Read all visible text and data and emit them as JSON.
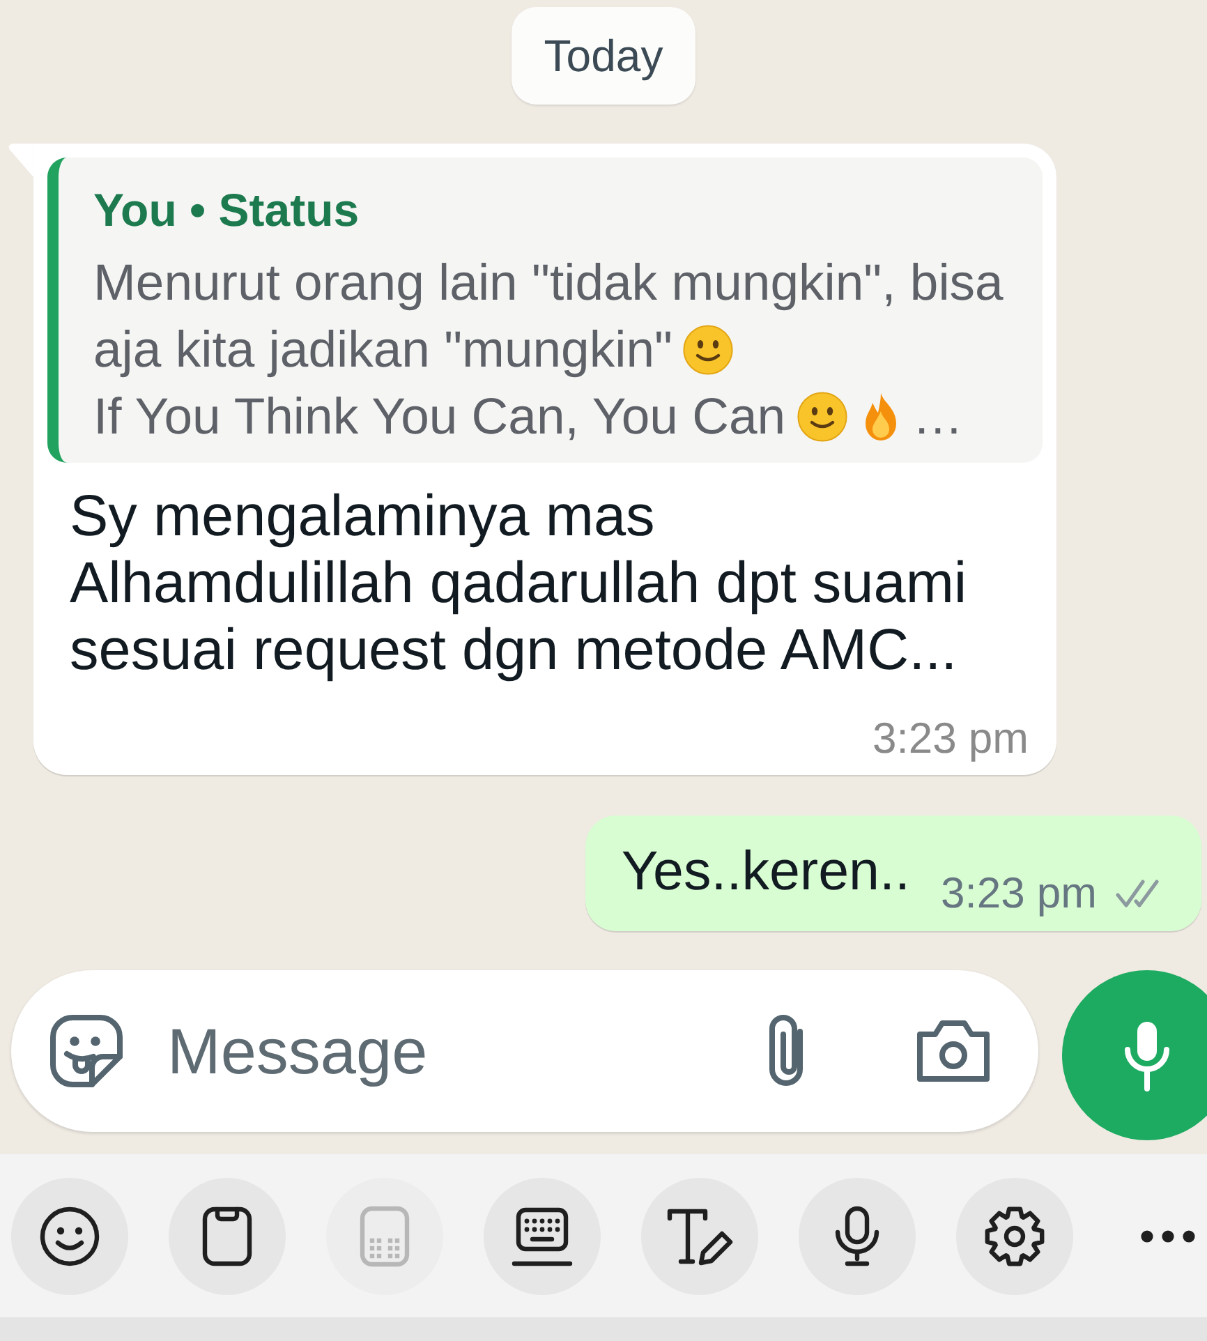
{
  "date_separator": "Today",
  "messages": [
    {
      "kind": "incoming",
      "quote": {
        "title": "You • Status",
        "lines": [
          {
            "text": "Menurut orang lain \"tidak mungkin\", bisa"
          },
          {
            "text": "aja kita jadikan \"mungkin\"",
            "emoji": [
              {
                "kind": "smile"
              }
            ]
          },
          {
            "text": "If You Think You Can, You Can",
            "emoji": [
              {
                "kind": "smile"
              },
              {
                "kind": "fire"
              }
            ],
            "suffix": "…"
          }
        ]
      },
      "text": "Sy mengalaminya mas Alhamdulillah qadarullah dpt suami sesuai request dgn metode AMC...",
      "time": "3:23 pm"
    },
    {
      "kind": "outgoing",
      "text": "Yes..keren..",
      "time": "3:23 pm",
      "read": false
    }
  ],
  "composer": {
    "placeholder": "Message"
  },
  "keyboard_toolbar": [
    {
      "kind": "emoji",
      "disabled": false
    },
    {
      "kind": "clipboard",
      "disabled": false
    },
    {
      "kind": "numpad",
      "disabled": true
    },
    {
      "kind": "keyboard",
      "disabled": false
    },
    {
      "kind": "handwriting",
      "disabled": false
    },
    {
      "kind": "voice",
      "disabled": false
    },
    {
      "kind": "settings",
      "disabled": false
    },
    {
      "kind": "more",
      "disabled": false
    }
  ]
}
